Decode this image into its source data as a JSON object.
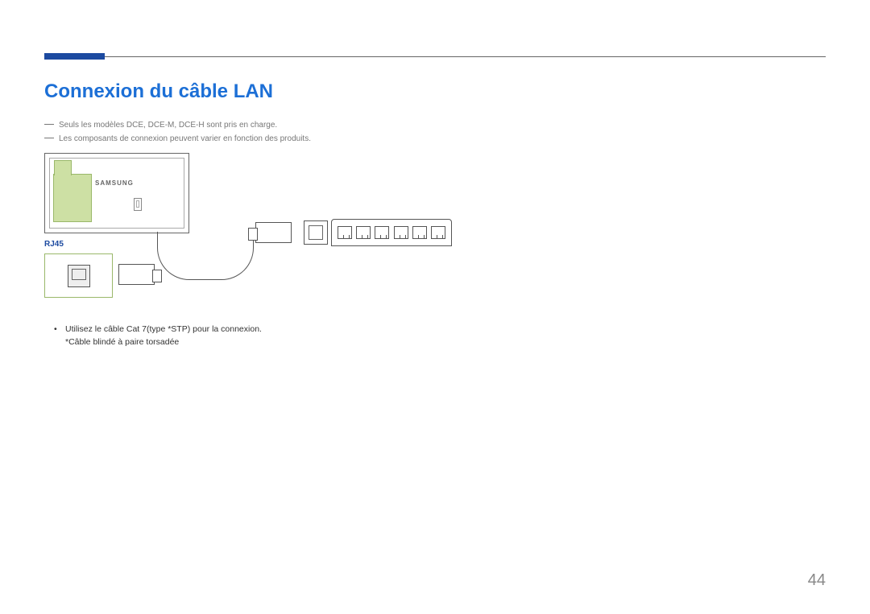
{
  "header": {
    "title": "Connexion du câble LAN"
  },
  "notes": [
    "Seuls les modèles DCE, DCE-M, DCE-H sont pris en charge.",
    "Les composants de connexion peuvent varier en fonction des produits."
  ],
  "diagram": {
    "brand_text": "SAMSUNG",
    "port_label": "RJ45"
  },
  "bullets": [
    {
      "line1": "Utilisez le câble Cat 7(type *STP) pour la connexion.",
      "line2": "*Câble blindé à paire torsadée"
    }
  ],
  "page_number": "44"
}
